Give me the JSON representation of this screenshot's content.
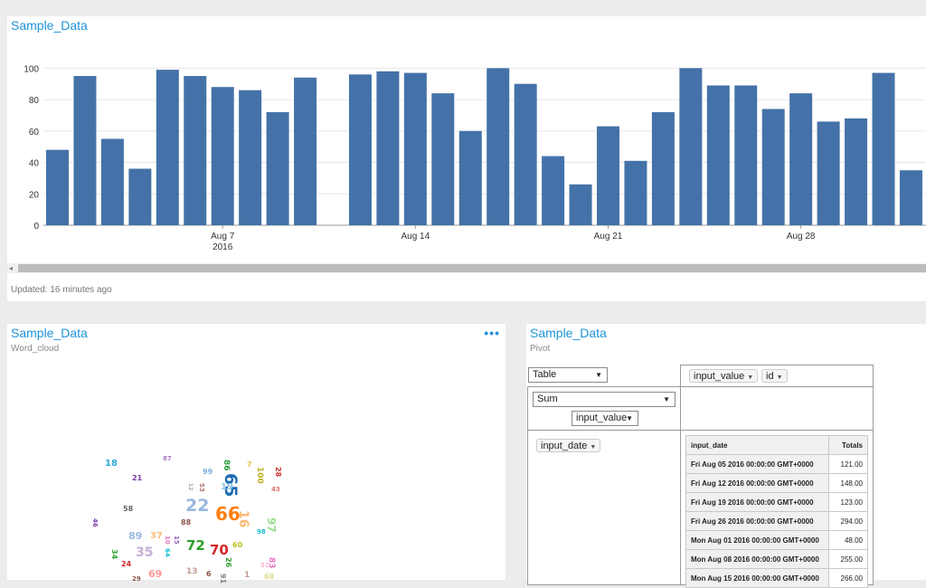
{
  "top_panel": {
    "title": "Sample_Data",
    "updated": "Updated: 16 minutes ago"
  },
  "chart_data": {
    "type": "bar",
    "x": [
      "2016-08-01",
      "2016-08-02",
      "2016-08-03",
      "2016-08-04",
      "2016-08-05",
      "2016-08-06",
      "2016-08-07",
      "2016-08-08",
      "2016-08-09",
      "2016-08-10",
      "2016-08-12",
      "2016-08-13",
      "2016-08-14",
      "2016-08-15",
      "2016-08-16",
      "2016-08-17",
      "2016-08-18",
      "2016-08-19",
      "2016-08-20",
      "2016-08-21",
      "2016-08-22",
      "2016-08-23",
      "2016-08-24",
      "2016-08-25",
      "2016-08-26",
      "2016-08-27",
      "2016-08-28",
      "2016-08-29",
      "2016-08-30",
      "2016-08-31",
      "2016-09-01"
    ],
    "values": [
      48,
      95,
      55,
      36,
      99,
      95,
      88,
      86,
      72,
      94,
      96,
      98,
      97,
      84,
      60,
      100,
      90,
      44,
      26,
      63,
      41,
      72,
      100,
      89,
      89,
      74,
      84,
      66,
      68,
      97,
      35
    ],
    "ylim": [
      0,
      110
    ],
    "yticks": [
      "0",
      "20",
      "40",
      "60",
      "80",
      "100"
    ],
    "xtick_labels": [
      {
        "date": "2016-08-07",
        "label": "Aug 7",
        "sub": "2016"
      },
      {
        "date": "2016-08-14",
        "label": "Aug 14",
        "sub": ""
      },
      {
        "date": "2016-08-21",
        "label": "Aug 21",
        "sub": ""
      },
      {
        "date": "2016-08-28",
        "label": "Aug 28",
        "sub": ""
      }
    ],
    "grid": true,
    "colors": {
      "bar": "#4472a8"
    }
  },
  "wordcloud_panel": {
    "title": "Sample_Data",
    "subtitle": "Word_cloud",
    "more": "•••",
    "words": [
      {
        "text": "18",
        "color": "#2aa9d6",
        "size": 10,
        "rot": 0
      },
      {
        "text": "87",
        "color": "#a97ac6",
        "size": 7,
        "rot": 0
      },
      {
        "text": "86",
        "color": "#2a9d3a",
        "size": 9,
        "rot": 90
      },
      {
        "text": "7",
        "color": "#e5c04a",
        "size": 8,
        "rot": 0
      },
      {
        "text": "100",
        "color": "#c0b020",
        "size": 9,
        "rot": 90
      },
      {
        "text": "28",
        "color": "#d0302a",
        "size": 8,
        "rot": 90
      },
      {
        "text": "21",
        "color": "#7a3aaa",
        "size": 8,
        "rot": 0
      },
      {
        "text": "99",
        "color": "#7ab0e0",
        "size": 8,
        "rot": 0
      },
      {
        "text": "43",
        "color": "#e07060",
        "size": 7,
        "rot": 0
      },
      {
        "text": "65",
        "color": "#1e6cb4",
        "size": 19,
        "rot": 90
      },
      {
        "text": "19",
        "color": "#8ec5e8",
        "size": 10,
        "rot": 0
      },
      {
        "text": "53",
        "color": "#b07070",
        "size": 7,
        "rot": 90
      },
      {
        "text": "12",
        "color": "#b0a0a0",
        "size": 6,
        "rot": 90
      },
      {
        "text": "58",
        "color": "#666666",
        "size": 8,
        "rot": 0
      },
      {
        "text": "22",
        "color": "#9ab8e0",
        "size": 19,
        "rot": 0
      },
      {
        "text": "66",
        "color": "#ff7f0e",
        "size": 20,
        "rot": 0
      },
      {
        "text": "16",
        "color": "#ffbb78",
        "size": 14,
        "rot": 90
      },
      {
        "text": "97",
        "color": "#98df8a",
        "size": 12,
        "rot": 90
      },
      {
        "text": "46",
        "color": "#7a3aaa",
        "size": 7,
        "rot": 90
      },
      {
        "text": "88",
        "color": "#8c564b",
        "size": 8,
        "rot": 0
      },
      {
        "text": "98",
        "color": "#17becf",
        "size": 7,
        "rot": 0
      },
      {
        "text": "89",
        "color": "#9ab8e0",
        "size": 11,
        "rot": 0
      },
      {
        "text": "37",
        "color": "#ffbb78",
        "size": 10,
        "rot": 0
      },
      {
        "text": "10",
        "color": "#e377c2",
        "size": 7,
        "rot": 90
      },
      {
        "text": "35",
        "color": "#c5b0d5",
        "size": 14,
        "rot": 0
      },
      {
        "text": "72",
        "color": "#2ca02c",
        "size": 15,
        "rot": 0
      },
      {
        "text": "70",
        "color": "#d62728",
        "size": 15,
        "rot": 0
      },
      {
        "text": "60",
        "color": "#bcbd22",
        "size": 8,
        "rot": 0
      },
      {
        "text": "64",
        "color": "#17becf",
        "size": 7,
        "rot": 90
      },
      {
        "text": "34",
        "color": "#2ca02c",
        "size": 8,
        "rot": 90
      },
      {
        "text": "15",
        "color": "#9467bd",
        "size": 7,
        "rot": 90
      },
      {
        "text": "24",
        "color": "#d62728",
        "size": 8,
        "rot": 0
      },
      {
        "text": "26",
        "color": "#2ca02c",
        "size": 8,
        "rot": 90
      },
      {
        "text": "83",
        "color": "#e377c2",
        "size": 9,
        "rot": 90
      },
      {
        "text": "52",
        "color": "#f7b6d2",
        "size": 7,
        "rot": 0
      },
      {
        "text": "69",
        "color": "#ff9896",
        "size": 11,
        "rot": 0
      },
      {
        "text": "29",
        "color": "#8c564b",
        "size": 7,
        "rot": 0
      },
      {
        "text": "13",
        "color": "#c49c94",
        "size": 9,
        "rot": 0
      },
      {
        "text": "6",
        "color": "#8c564b",
        "size": 8,
        "rot": 0
      },
      {
        "text": "91",
        "color": "#7f7f7f",
        "size": 8,
        "rot": 90
      },
      {
        "text": "1",
        "color": "#c49c94",
        "size": 9,
        "rot": 0
      },
      {
        "text": "68",
        "color": "#dbdb8d",
        "size": 8,
        "rot": 0
      }
    ]
  },
  "pivot_panel": {
    "title": "Sample_Data",
    "subtitle": "Pivot",
    "renderer": "Table",
    "aggregator": "Sum",
    "agg_field": "input_value",
    "col_fields": [
      "input_value",
      "id"
    ],
    "row_field": "input_date",
    "table": {
      "header_label": "input_date",
      "header_total": "Totals",
      "rows": [
        {
          "date": "Fri Aug 05 2016 00:00:00 GMT+0000",
          "total": "121.00"
        },
        {
          "date": "Fri Aug 12 2016 00:00:00 GMT+0000",
          "total": "148.00"
        },
        {
          "date": "Fri Aug 19 2016 00:00:00 GMT+0000",
          "total": "123.00"
        },
        {
          "date": "Fri Aug 26 2016 00:00:00 GMT+0000",
          "total": "294.00"
        },
        {
          "date": "Mon Aug 01 2016 00:00:00 GMT+0000",
          "total": "48.00"
        },
        {
          "date": "Mon Aug 08 2016 00:00:00 GMT+0000",
          "total": "255.00"
        },
        {
          "date": "Mon Aug 15 2016 00:00:00 GMT+0000",
          "total": "266.00"
        }
      ]
    }
  }
}
